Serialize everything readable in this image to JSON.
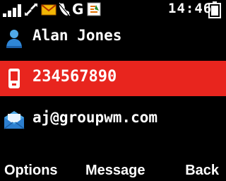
{
  "status_bar": {
    "signal_icon": "signal-bars-icon",
    "data_icon": "gprs-transfer-icon",
    "message_icon": "envelope-icon",
    "silent_icon": "silent-mode-icon",
    "network_letter": "G",
    "java_icon": "java-app-icon",
    "time": "14:46",
    "battery_icon": "battery-icon"
  },
  "contact": {
    "name": "Alan Jones",
    "phone": "234567890",
    "email": "aj@groupwm.com",
    "name_icon": "person-icon",
    "phone_icon": "mobile-phone-icon",
    "email_icon": "email-icon"
  },
  "softkeys": {
    "left": "Options",
    "center": "Message",
    "right": "Back"
  },
  "colors": {
    "highlight": "#e8251e",
    "background": "#000000",
    "text": "#ffffff"
  }
}
